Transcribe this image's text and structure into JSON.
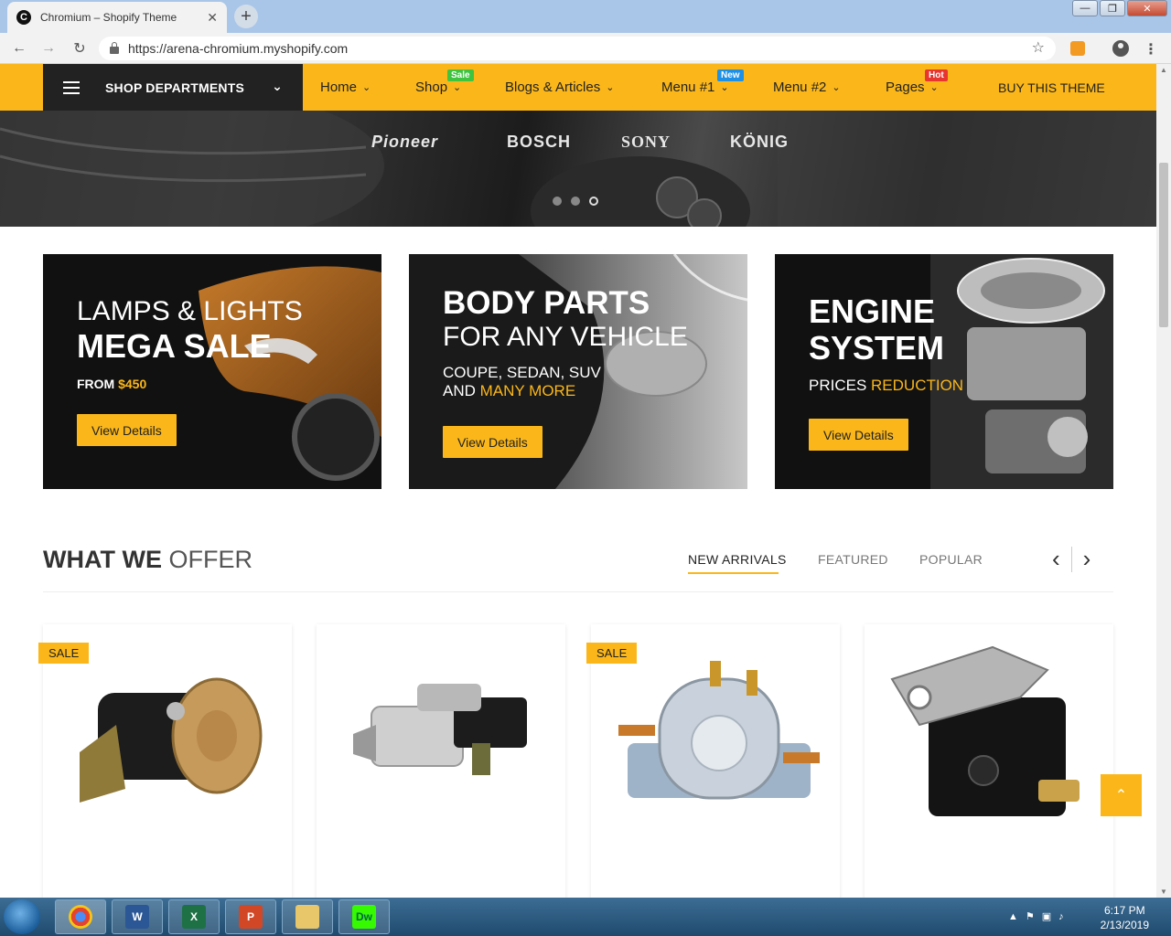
{
  "browser": {
    "tab_title": "Chromium – Shopify Theme",
    "tab_favicon": "C",
    "url": "https://arena-chromium.myshopify.com",
    "window_controls": [
      "—",
      "❐",
      "✕"
    ]
  },
  "nav": {
    "departments_label": "SHOP DEPARTMENTS",
    "items": [
      {
        "label": "Home",
        "badge": ""
      },
      {
        "label": "Shop",
        "badge": "Sale",
        "badge_color": "#3fc43f"
      },
      {
        "label": "Blogs & Articles",
        "badge": ""
      },
      {
        "label": "Menu #1",
        "badge": "New",
        "badge_color": "#1e90e6"
      },
      {
        "label": "Menu #2",
        "badge": ""
      },
      {
        "label": "Pages",
        "badge": "Hot",
        "badge_color": "#e8352f"
      }
    ],
    "buy_theme": "BUY THIS THEME"
  },
  "hero": {
    "brands": [
      "Pioneer",
      "BOSCH",
      "SONY",
      "KÖNIG"
    ],
    "active_slide": 3,
    "slide_count": 3
  },
  "banners": [
    {
      "line1": "LAMPS & LIGHTS",
      "line2": "MEGA SALE",
      "sub_prefix": "FROM ",
      "sub_highlight": "$450",
      "button": "View Details"
    },
    {
      "line1": "BODY PARTS",
      "line2": "FOR ANY VEHICLE",
      "sub_line1": "COUPE, SEDAN, SUV",
      "sub_prefix": "AND ",
      "sub_highlight": "MANY MORE",
      "button": "View Details"
    },
    {
      "line1": "ENGINE",
      "line2": "SYSTEM",
      "sub_prefix": "PRICES ",
      "sub_highlight": "REDUCTION",
      "button": "View Details"
    }
  ],
  "offer": {
    "title_bold": "WHAT WE",
    "title_light": "OFFER",
    "tabs": [
      "NEW ARRIVALS",
      "FEATURED",
      "POPULAR"
    ],
    "active_tab": "NEW ARRIVALS",
    "prev_icon": "‹",
    "next_icon": "›"
  },
  "products": [
    {
      "sale_label": "SALE",
      "image": "starter-motor-black"
    },
    {
      "sale_label": "",
      "image": "starter-motor-silver"
    },
    {
      "sale_label": "SALE",
      "image": "solenoid-silver"
    },
    {
      "sale_label": "",
      "image": "solenoid-black"
    }
  ],
  "back_to_top": "⌃",
  "taskbar": {
    "apps": [
      "Chrome",
      "W",
      "X",
      "P",
      "Folder",
      "Dw"
    ],
    "time": "6:17 PM",
    "date": "2/13/2019"
  },
  "colors": {
    "accent": "#fbb71a",
    "dark": "#222222"
  }
}
